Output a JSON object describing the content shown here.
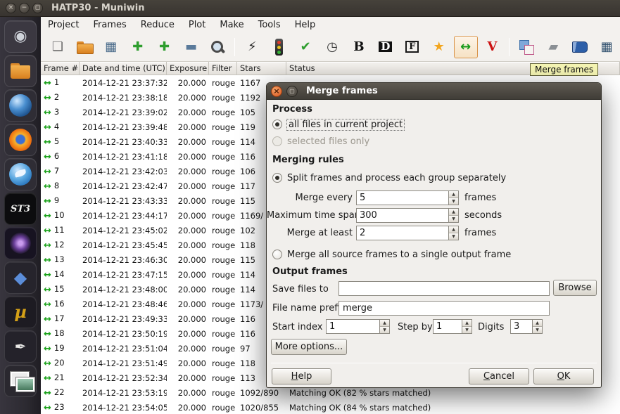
{
  "panel": {
    "title": "HATP30 - Muniwin",
    "window_buttons": [
      {
        "name": "close-button",
        "glyph": "×"
      },
      {
        "name": "minimize-button",
        "glyph": "−"
      },
      {
        "name": "maximize-button",
        "glyph": "◻"
      }
    ]
  },
  "dock": {
    "items": [
      {
        "name": "dash-launcher",
        "glyph": "◉",
        "fg": "#cfd3da",
        "tile": "#3b3841"
      },
      {
        "name": "files-launcher",
        "shape": "folder",
        "tile": "#35323a"
      },
      {
        "name": "browser-launcher",
        "shape": "globe",
        "tile": "#2f2d35"
      },
      {
        "name": "firefox-launcher",
        "shape": "firefox",
        "tile": "#2f2d35"
      },
      {
        "name": "thunderbird-launcher",
        "shape": "tbird",
        "tile": "#2f2d35"
      },
      {
        "name": "st3-launcher",
        "glyph": "ST3",
        "fg": "#f0f0ee",
        "tile": "#0c0c0e",
        "serif": true,
        "size": "13"
      },
      {
        "name": "planetarium-launcher",
        "shape": "nebula",
        "tile": "#171321"
      },
      {
        "name": "cube-launcher",
        "glyph": "◆",
        "fg": "#5b8dd9",
        "tile": "#26242c",
        "size": "24"
      },
      {
        "name": "muniwin-launcher",
        "glyph": "µ",
        "fg": "#d4a017",
        "tile": "#1d1b22",
        "serif": true,
        "size": "24"
      },
      {
        "name": "pen-launcher",
        "glyph": "✒",
        "fg": "#e8e8e6",
        "tile": "#24222a",
        "size": "20"
      },
      {
        "name": "photos-launcher",
        "shape": "photos",
        "tile": "#2a282f"
      }
    ]
  },
  "menubar": {
    "items": [
      "Project",
      "Frames",
      "Reduce",
      "Plot",
      "Make",
      "Tools",
      "Help"
    ]
  },
  "toolbar": {
    "tooltip": "Merge frames",
    "buttons": [
      {
        "name": "new-file-icon",
        "glyph": "❏",
        "color": "#6b6b6b"
      },
      {
        "name": "open-folder-icon",
        "shape": "folder"
      },
      {
        "name": "frame-list-icon",
        "glyph": "▦",
        "color": "#4a6b8a"
      },
      {
        "name": "add-files-icon",
        "glyph": "✚",
        "color": "#2e9e2e"
      },
      {
        "name": "add-folder-icon",
        "glyph": "✚",
        "color": "#2e9e2e"
      },
      {
        "name": "remove-files-icon",
        "glyph": "▬",
        "color": "#5a7a9a"
      },
      {
        "name": "search-icon",
        "shape": "magnifier"
      },
      {
        "sep": true
      },
      {
        "name": "express-reduction-icon",
        "glyph": "⚡",
        "color": "#222222"
      },
      {
        "name": "process-status-icon",
        "shape": "traffic"
      },
      {
        "name": "convert-icon",
        "glyph": "✔",
        "color": "#2e9e2e"
      },
      {
        "name": "time-correction-icon",
        "glyph": "◷",
        "color": "#333333"
      },
      {
        "name": "bias-correction-icon",
        "glyph": "B",
        "color": "#111111",
        "serif": true,
        "bold": true
      },
      {
        "name": "dark-correction-icon",
        "glyph": "D",
        "color": "#ffffff",
        "bg": "#111111",
        "serif": true,
        "bold": true
      },
      {
        "name": "flat-correction-icon",
        "glyph": "F",
        "color": "#111111",
        "boxed": true,
        "serif": true,
        "bold": true
      },
      {
        "name": "photometry-icon",
        "glyph": "★",
        "color": "#f2a51d"
      },
      {
        "name": "merge-frames-icon",
        "glyph": "↔",
        "color": "#1a9b1a",
        "bold": true,
        "hover": true
      },
      {
        "name": "find-variables-icon",
        "glyph": "V",
        "color": "#cc1111",
        "serif": true,
        "bold": true
      },
      {
        "sep": true
      },
      {
        "name": "aperture-icon",
        "shape": "copy"
      },
      {
        "name": "eraser-icon",
        "glyph": "▰",
        "color": "#8a8f94"
      },
      {
        "name": "catalog-icon",
        "shape": "book"
      },
      {
        "name": "table-view-icon",
        "glyph": "▦",
        "color": "#30506e"
      }
    ]
  },
  "table": {
    "columns": [
      "Frame #",
      "Date and time (UTC)",
      "Exposure",
      "Filter",
      "Stars",
      "Status"
    ],
    "rows": [
      [
        "1",
        "2014-12-21 23:37:32",
        "20.000",
        "rouge",
        "1167",
        ""
      ],
      [
        "2",
        "2014-12-21 23:38:18",
        "20.000",
        "rouge",
        "1192",
        ""
      ],
      [
        "3",
        "2014-12-21 23:39:02",
        "20.000",
        "rouge",
        "105",
        ""
      ],
      [
        "4",
        "2014-12-21 23:39:48",
        "20.000",
        "rouge",
        "119",
        ""
      ],
      [
        "5",
        "2014-12-21 23:40:33",
        "20.000",
        "rouge",
        "114",
        ""
      ],
      [
        "6",
        "2014-12-21 23:41:18",
        "20.000",
        "rouge",
        "116",
        ""
      ],
      [
        "7",
        "2014-12-21 23:42:03",
        "20.000",
        "rouge",
        "106",
        ""
      ],
      [
        "8",
        "2014-12-21 23:42:47",
        "20.000",
        "rouge",
        "117",
        ""
      ],
      [
        "9",
        "2014-12-21 23:43:33",
        "20.000",
        "rouge",
        "115",
        ""
      ],
      [
        "10",
        "2014-12-21 23:44:17",
        "20.000",
        "rouge",
        "1169/",
        ""
      ],
      [
        "11",
        "2014-12-21 23:45:02",
        "20.000",
        "rouge",
        "102",
        ""
      ],
      [
        "12",
        "2014-12-21 23:45:45",
        "20.000",
        "rouge",
        "118",
        ""
      ],
      [
        "13",
        "2014-12-21 23:46:30",
        "20.000",
        "rouge",
        "115",
        ""
      ],
      [
        "14",
        "2014-12-21 23:47:15",
        "20.000",
        "rouge",
        "114",
        ""
      ],
      [
        "15",
        "2014-12-21 23:48:00",
        "20.000",
        "rouge",
        "114",
        ""
      ],
      [
        "16",
        "2014-12-21 23:48:46",
        "20.000",
        "rouge",
        "1173/",
        ""
      ],
      [
        "17",
        "2014-12-21 23:49:33",
        "20.000",
        "rouge",
        "116",
        ""
      ],
      [
        "18",
        "2014-12-21 23:50:19",
        "20.000",
        "rouge",
        "116",
        ""
      ],
      [
        "19",
        "2014-12-21 23:51:04",
        "20.000",
        "rouge",
        "97",
        ""
      ],
      [
        "20",
        "2014-12-21 23:51:49",
        "20.000",
        "rouge",
        "118",
        ""
      ],
      [
        "21",
        "2014-12-21 23:52:34",
        "20.000",
        "rouge",
        "113",
        ""
      ],
      [
        "22",
        "2014-12-21 23:53:19",
        "20.000",
        "rouge",
        "1092/890",
        "Matching OK (82 % stars matched)"
      ],
      [
        "23",
        "2014-12-21 23:54:05",
        "20.000",
        "rouge",
        "1020/855",
        "Matching OK (84 % stars matched)"
      ]
    ]
  },
  "dialog": {
    "title": "Merge frames",
    "process_label": "Process",
    "radio_all": "all files in current project",
    "radio_selected": "selected files only",
    "merging_label": "Merging rules",
    "radio_split": "Split frames and process each group separately",
    "merge_every_label": "Merge every",
    "merge_every_value": "5",
    "merge_every_suffix": "frames",
    "max_span_label": "Maximum time span",
    "max_span_value": "300",
    "max_span_suffix": "seconds",
    "merge_least_label": "Merge at least",
    "merge_least_value": "2",
    "merge_least_suffix": "frames",
    "radio_single": "Merge all source frames to a single output frame",
    "output_label": "Output frames",
    "save_to_label": "Save files to",
    "save_to_value": "",
    "browse_label": "Browse",
    "prefix_label": "File name prefix",
    "prefix_value": "merge",
    "start_label": "Start index at",
    "start_value": "1",
    "step_label": "Step by",
    "step_value": "1",
    "digits_label": "Digits",
    "digits_value": "3",
    "more_label": "More options...",
    "help_label": "Help",
    "cancel_label": "Cancel",
    "ok_label": "OK"
  }
}
